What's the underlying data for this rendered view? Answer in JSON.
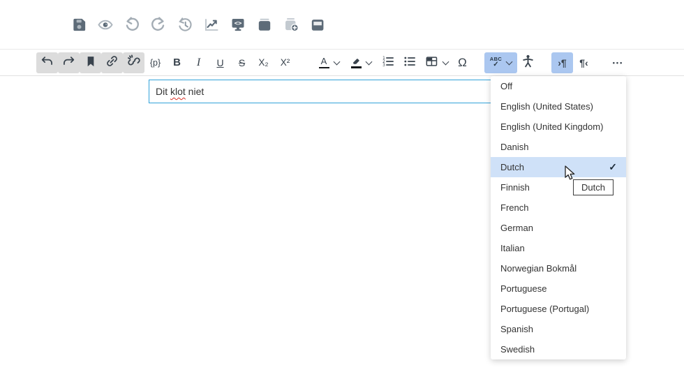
{
  "top_toolbar": {
    "icons": [
      "save",
      "preview",
      "undo",
      "redo",
      "revision-history",
      "statistics",
      "source-code",
      "archive",
      "duplicate-add",
      "storage"
    ]
  },
  "format_toolbar": {
    "code": "{p}",
    "bold": "B",
    "italic": "I",
    "underline": "U",
    "strikethrough": "S",
    "subscript": "X₂",
    "superscript": "X²",
    "font_color": "A",
    "special_characters": "Ω",
    "spellcheck_abc": "ABC",
    "spellcheck_check": "✓",
    "ltr": "›¶",
    "rtl": "¶‹",
    "more": "•••"
  },
  "editor": {
    "text_before": "Dit ",
    "misspelled_word": "klot",
    "text_after": " niet"
  },
  "spellcheck_menu": {
    "items": [
      {
        "label": "Off",
        "selected": false
      },
      {
        "label": "English (United States)",
        "selected": false
      },
      {
        "label": "English (United Kingdom)",
        "selected": false
      },
      {
        "label": "Danish",
        "selected": false
      },
      {
        "label": "Dutch",
        "selected": true
      },
      {
        "label": "Finnish",
        "selected": false
      },
      {
        "label": "French",
        "selected": false
      },
      {
        "label": "German",
        "selected": false
      },
      {
        "label": "Italian",
        "selected": false
      },
      {
        "label": "Norwegian Bokmål",
        "selected": false
      },
      {
        "label": "Portuguese",
        "selected": false
      },
      {
        "label": "Portuguese (Portugal)",
        "selected": false
      },
      {
        "label": "Spanish",
        "selected": false
      },
      {
        "label": "Swedish",
        "selected": false
      }
    ],
    "checkmark": "✓"
  },
  "tooltip": {
    "text": "Dutch"
  },
  "colors": {
    "toolbar_active_blue": "#abc7f0",
    "menu_selected_blue": "#cfe1f8",
    "editor_focus_border": "#31a2d9",
    "spellcheck_underline_red": "#d93025",
    "button_active_gray": "#dcdcdc"
  }
}
